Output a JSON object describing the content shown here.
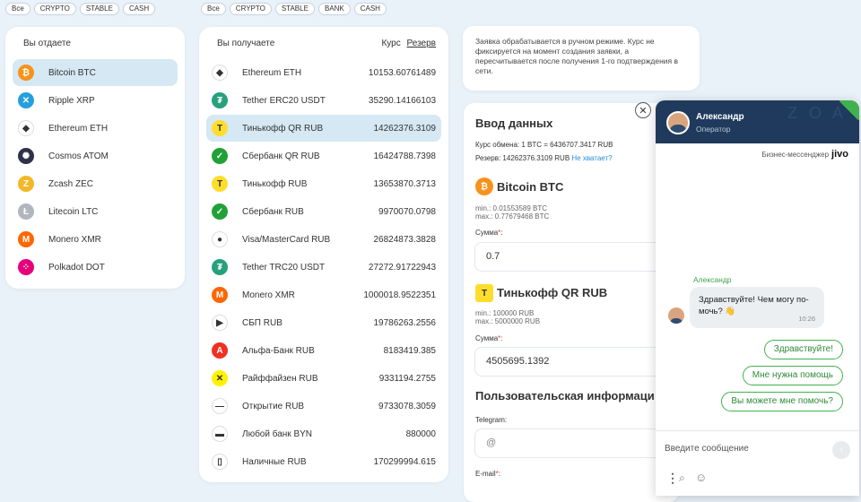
{
  "left_filters": [
    "Все",
    "CRYPTO",
    "STABLE",
    "CASH"
  ],
  "right_filters": [
    "Все",
    "CRYPTO",
    "STABLE",
    "BANK",
    "CASH"
  ],
  "give": {
    "title": "Вы отдаете",
    "items": [
      {
        "name": "Bitcoin BTC",
        "icon": "bitcoin-icon",
        "color": "#f7931a",
        "glyph": "₿"
      },
      {
        "name": "Ripple XRP",
        "icon": "ripple-icon",
        "color": "#23a0dd",
        "glyph": "✕"
      },
      {
        "name": "Ethereum ETH",
        "icon": "ethereum-icon",
        "color": "#ffffff",
        "glyph": "◆"
      },
      {
        "name": "Cosmos ATOM",
        "icon": "cosmos-icon",
        "color": "#2e3148",
        "glyph": "✺"
      },
      {
        "name": "Zcash ZEC",
        "icon": "zcash-icon",
        "color": "#f4b728",
        "glyph": "Z"
      },
      {
        "name": "Litecoin LTC",
        "icon": "litecoin-icon",
        "color": "#b0b6bd",
        "glyph": "Ł"
      },
      {
        "name": "Monero XMR",
        "icon": "monero-icon",
        "color": "#ff6600",
        "glyph": "M"
      },
      {
        "name": "Polkadot DOT",
        "icon": "polkadot-icon",
        "color": "#e6007a",
        "glyph": "⁘"
      }
    ]
  },
  "get": {
    "title": "Вы получаете",
    "rate_label": "Курс",
    "reserve_label": "Резерв",
    "items": [
      {
        "name": "Ethereum ETH",
        "value": "10153.60761489",
        "icon": "ethereum-icon",
        "color": "#ffffff",
        "glyph": "◆"
      },
      {
        "name": "Tether ERC20 USDT",
        "value": "35290.14166103",
        "icon": "tether-icon",
        "color": "#26a17b",
        "glyph": "₮"
      },
      {
        "name": "Тинькофф QR RUB",
        "value": "14262376.3109",
        "icon": "tinkoff-icon",
        "color": "#ffdd2d",
        "glyph": "T"
      },
      {
        "name": "Сбербанк QR RUB",
        "value": "16424788.7398",
        "icon": "sberbank-icon",
        "color": "#21a038",
        "glyph": "✓"
      },
      {
        "name": "Тинькофф RUB",
        "value": "13653870.3713",
        "icon": "tinkoff-icon",
        "color": "#ffdd2d",
        "glyph": "T"
      },
      {
        "name": "Сбербанк RUB",
        "value": "9970070.0798",
        "icon": "sberbank-icon",
        "color": "#21a038",
        "glyph": "✓"
      },
      {
        "name": "Visa/MasterCard RUB",
        "value": "26824873.3828",
        "icon": "card-icon",
        "color": "#ffffff",
        "glyph": "●"
      },
      {
        "name": "Tether TRC20 USDT",
        "value": "27272.91722943",
        "icon": "tether-icon",
        "color": "#26a17b",
        "glyph": "₮"
      },
      {
        "name": "Monero XMR",
        "value": "1000018.9522351",
        "icon": "monero-icon",
        "color": "#ff6600",
        "glyph": "M"
      },
      {
        "name": "СБП RUB",
        "value": "19786263.2556",
        "icon": "sbp-icon",
        "color": "#ffffff",
        "glyph": "▶"
      },
      {
        "name": "Альфа-Банк RUB",
        "value": "8183419.385",
        "icon": "alfa-icon",
        "color": "#ef3124",
        "glyph": "A"
      },
      {
        "name": "Райффайзен RUB",
        "value": "9331194.2755",
        "icon": "raiffeisen-icon",
        "color": "#fff200",
        "glyph": "✕"
      },
      {
        "name": "Открытие RUB",
        "value": "9733078.3059",
        "icon": "otkritie-icon",
        "color": "#ffffff",
        "glyph": "—"
      },
      {
        "name": "Любой банк BYN",
        "value": "880000",
        "icon": "bank-icon",
        "color": "#ffffff",
        "glyph": "▬"
      },
      {
        "name": "Наличные RUB",
        "value": "170299994.615",
        "icon": "cash-icon",
        "color": "#ffffff",
        "glyph": "▯"
      }
    ]
  },
  "notice": "Заявка обрабатывается в ручном режиме. Курс не фиксируется на момент создания заявки, а пересчитывается после получения 1-го подтверждения в сети.",
  "form": {
    "title": "Ввод данных",
    "rate": "Курс обмена: 1 BTC = 6436707.3417 RUB",
    "reserve": "Резерв: 14262376.3109 RUB",
    "reserve_link": "Не хватает?",
    "from_name": "Bitcoin BTC",
    "from_min": "min.: 0.01553589 BTC",
    "from_max": "max.: 0.77679468 BTC",
    "sum_label": "Сумма",
    "from_value": "0.7",
    "to_name": "Тинькофф QR RUB",
    "to_min": "min.: 100000 RUB",
    "to_max": "max.: 5000000 RUB",
    "to_value": "4505695.1392",
    "user_title": "Пользовательская информаци",
    "telegram_label": "Telegram:",
    "telegram_placeholder": "@",
    "email_label": "E-mail"
  },
  "chat": {
    "agent_name": "Александр",
    "agent_role": "Оператор",
    "brand": "Бизнес-мессенджер",
    "brand_logo": "jivo",
    "sender": "Александр",
    "message": "Здравствуйте! Чем могу по-мочь? 👋",
    "time": "10:26",
    "quick_replies": [
      "Здравствуйте!",
      "Мне нужна помощь",
      "Вы можете мне помочь?"
    ],
    "input_placeholder": "Введите сообщение"
  }
}
